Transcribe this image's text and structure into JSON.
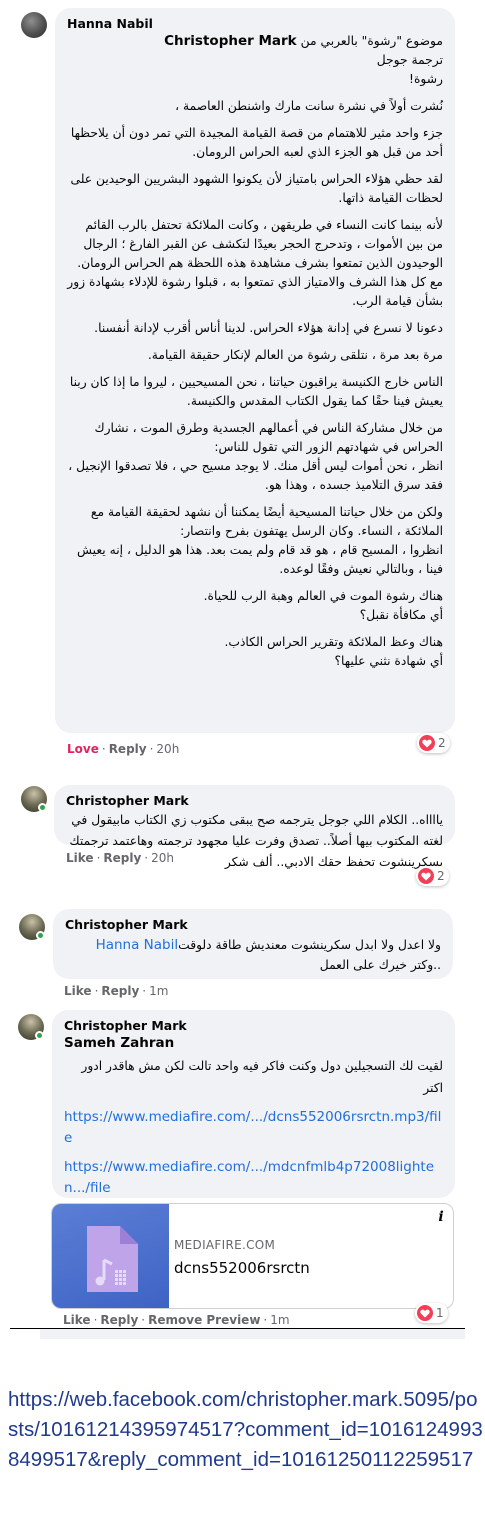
{
  "comment1": {
    "author": "Hanna Nabil",
    "mention": "Christopher Mark",
    "paragraphs": [
      "موضوع \"رشوة\" بالعربي من",
      "ترجمة جوجل\nرشوة!",
      "نُشرت أولاً في نشرة سانت مارك واشنطن العاصمة ،",
      "جزء واحد مثير للاهتمام من قصة القيامة المجيدة التي تمر دون أن يلاحظها أحد من قبل هو الجزء الذي لعبه الحراس الرومان.",
      "لقد حظي هؤلاء الحراس بامتياز لأن يكونوا الشهود البشريين الوحيدين على لحظات القيامة ذاتها.",
      "لأنه بينما كانت النساء في طريقهن ، وكانت الملائكة تحتفل بالرب القائم من بين الأموات ، وتدحرج الحجر بعيدًا لتكشف عن القبر الفارغ ؛ الرجال الوحيدون الذين تمتعوا بشرف مشاهدة هذه اللحظة هم الحراس الرومان. مع كل هذا الشرف والامتياز الذي تمتعوا به ، قبلوا رشوة للإدلاء بشهادة زور بشأن قيامة الرب.",
      "دعونا لا نسرع في إدانة هؤلاء الحراس. لدينا أناس أقرب لإدانة أنفسنا.",
      "مرة بعد مرة ، نتلقى رشوة من العالم لإنكار حقيقة القيامة.",
      "الناس خارج الكنيسة يراقبون حياتنا ، نحن المسيحيين ، ليروا ما إذا كان ربنا يعيش فينا حقًا كما يقول الكتاب المقدس والكنيسة.",
      "من خلال مشاركة الناس في أعمالهم الجسدية وطرق الموت ، نشارك الحراس في شهادتهم الزور التي تقول للناس:\nانظر ، نحن أموات ليس أقل منك. لا يوجد مسيح حي ، فلا تصدقوا الإنجيل ، فقد سرق التلاميذ جسده ، وهذا هو.",
      "ولكن من خلال حياتنا المسيحية أيضًا يمكننا أن نشهد لحقيقة القيامة مع الملائكة ، النساء. وكان الرسل يهتفون بفرح وانتصار:\nانظروا ، المسيح قام ، هو قد قام ولم يمت بعد. هذا هو الدليل ، إنه يعيش فينا ، وبالتالي نعيش وفقًا لوعده.",
      "هناك رشوة الموت في العالم وهبة الرب للحياة.\nأي مكافأة نقبل؟",
      "هناك وعظ الملائكة وتقرير الحراس الكاذب.\nأي شهادة نثني عليها؟"
    ],
    "actions": {
      "love": "Love",
      "reply": "Reply",
      "time": "20h"
    },
    "reaction_count": "2"
  },
  "comment2": {
    "author": "Christopher Mark",
    "text": "يااااه.. الكلام اللي جوجل يترجمه صح يبقى مكتوب زي الكتاب مابيقول في لغته المكتوب بيها أصلاً.. تصدق وفرت عليا مجهود ترجمته وهاعتمد ترجمتك بسكرينشوت تحفظ حقك الادبي.. ألف شكر",
    "actions": {
      "like": "Like",
      "reply": "Reply",
      "time": "20h"
    },
    "reaction_count": "2"
  },
  "comment3": {
    "author": "Christopher Mark",
    "mention": "Hanna Nabil",
    "text_line1": "ولا اعدل ولا ابدل سكرينشوت معنديش طاقة دلوقت",
    "text_line2": "..وكتر خيرك على العمل",
    "actions": {
      "like": "Like",
      "reply": "Reply",
      "time": "1m"
    }
  },
  "comment4": {
    "author": "Christopher Mark",
    "mention": "Sameh Zahran",
    "text": "لقيت لك التسجيلين دول وكنت فاكر فيه واحد تالت لكن مش هاقدر ادور اكتر",
    "link1": "https://www.mediafire.com/.../dcns552006rsrctn.mp3/file",
    "link2": "https://www.mediafire.com/.../mdcnfmlb4p72008lighten.../file",
    "preview": {
      "domain": "MEDIAFIRE.COM",
      "title": "dcns552006rsrctn",
      "info": "i"
    },
    "actions": {
      "like": "Like",
      "reply": "Reply",
      "remove": "Remove Preview",
      "time": "1m"
    },
    "reaction_count": "1"
  },
  "caption": "https://web.facebook.com/christopher.mark.5095/posts/10161214395974517?comment_id=10161249938499517&reply_comment_id=10161250112259517"
}
